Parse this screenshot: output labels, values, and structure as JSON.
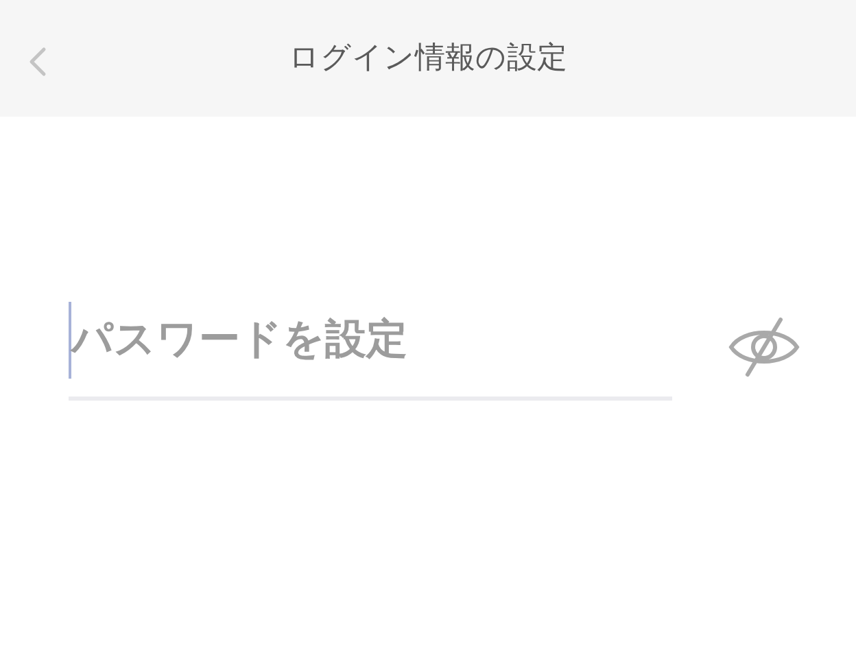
{
  "header": {
    "title": "ログイン情報の設定"
  },
  "password_field": {
    "placeholder": "パスワードを設定",
    "focused": true
  }
}
